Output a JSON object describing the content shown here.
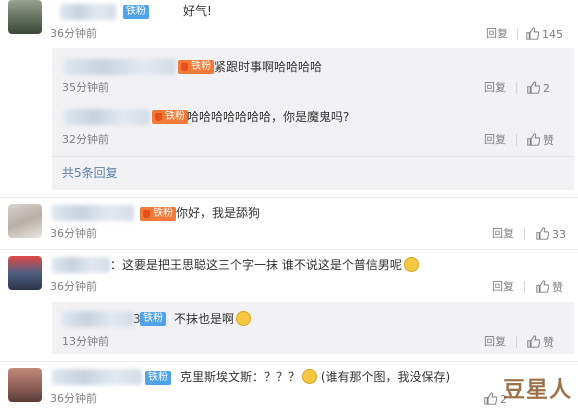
{
  "actions": {
    "reply_label": "回复"
  },
  "comments": [
    {
      "badge": "铁粉",
      "text": "好气!",
      "time": "36分钟前",
      "likes": "145"
    },
    {
      "badge": "铁粉",
      "text": "你好，我是舔狗",
      "time": "36分钟前",
      "likes": "33"
    },
    {
      "text": "：这要是把王思聪这三个字一抹 谁不说这是个普信男呢",
      "time": "36分钟前",
      "likes": "赞"
    },
    {
      "badge": "铁粉",
      "text": "克里斯埃文斯：？？？",
      "text2": "(谁有那个图，我没保存)",
      "time": "36分钟前",
      "likes": "2"
    }
  ],
  "thread1_replies": [
    {
      "badge": "铁粉",
      "text": "紧跟时事啊哈哈哈哈",
      "time": "35分钟前",
      "likes": "2"
    },
    {
      "badge": "铁粉",
      "text": "哈哈哈哈哈哈哈，你是魔鬼吗?",
      "time": "32分钟前",
      "likes": "赞"
    }
  ],
  "thread1_more": "共5条回复",
  "thread3_replies": [
    {
      "prefix": "3",
      "badge": "铁粉",
      "text": "不抹也是啊",
      "time": "13分钟前",
      "likes": "赞"
    }
  ],
  "watermark": "豆星人",
  "colors": {
    "link": "#5a7fa8",
    "badge_blue": "#4fa3e8",
    "badge_orange": "#f07a3a",
    "sub_bg": "#f2f2f5"
  }
}
